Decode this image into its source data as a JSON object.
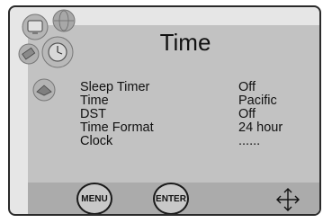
{
  "title": "Time",
  "settings": [
    {
      "label": "Sleep Timer",
      "value": "Off"
    },
    {
      "label": "Time",
      "value": "Pacific"
    },
    {
      "label": "DST",
      "value": "Off"
    },
    {
      "label": "Time Format",
      "value": "24 hour"
    },
    {
      "label": "Clock",
      "value": "......"
    }
  ],
  "buttons": {
    "menu": "MENU",
    "enter": "ENTER"
  },
  "icons": [
    "tv-icon",
    "globe-icon",
    "satellite-icon",
    "clock-icon",
    "settings-icon",
    "move-icon"
  ]
}
